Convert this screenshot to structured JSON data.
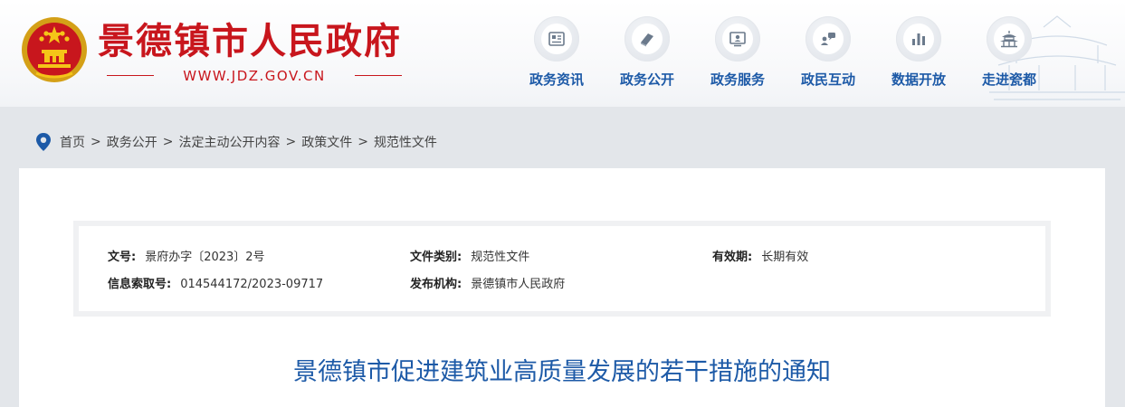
{
  "header": {
    "site_title": "景德镇市人民政府",
    "site_url": "WWW.JDZ.GOV.CN",
    "nav": [
      {
        "label": "政务资讯",
        "icon": "news-icon"
      },
      {
        "label": "政务公开",
        "icon": "book-icon"
      },
      {
        "label": "政务服务",
        "icon": "service-icon"
      },
      {
        "label": "政民互动",
        "icon": "chat-icon"
      },
      {
        "label": "数据开放",
        "icon": "bar-chart-icon"
      },
      {
        "label": "走进瓷都",
        "icon": "pavilion-icon"
      }
    ]
  },
  "breadcrumb": [
    "首页",
    "政务公开",
    "法定主动公开内容",
    "政策文件",
    "规范性文件"
  ],
  "breadcrumb_separator": ">",
  "meta": {
    "doc_number": {
      "label": "文号:",
      "value": "景府办字〔2023〕2号"
    },
    "doc_category": {
      "label": "文件类别:",
      "value": "规范性文件"
    },
    "validity": {
      "label": "有效期:",
      "value": "长期有效"
    },
    "index_number": {
      "label": "信息索取号:",
      "value": "014544172/2023-09717"
    },
    "issuer": {
      "label": "发布机构:",
      "value": "景德镇市人民政府"
    }
  },
  "document": {
    "title": "景德镇市促进建筑业高质量发展的若干措施的通知"
  },
  "colors": {
    "brand_red": "#c8161d",
    "nav_blue": "#1d5aa7",
    "page_bg": "#e3e6ea"
  }
}
